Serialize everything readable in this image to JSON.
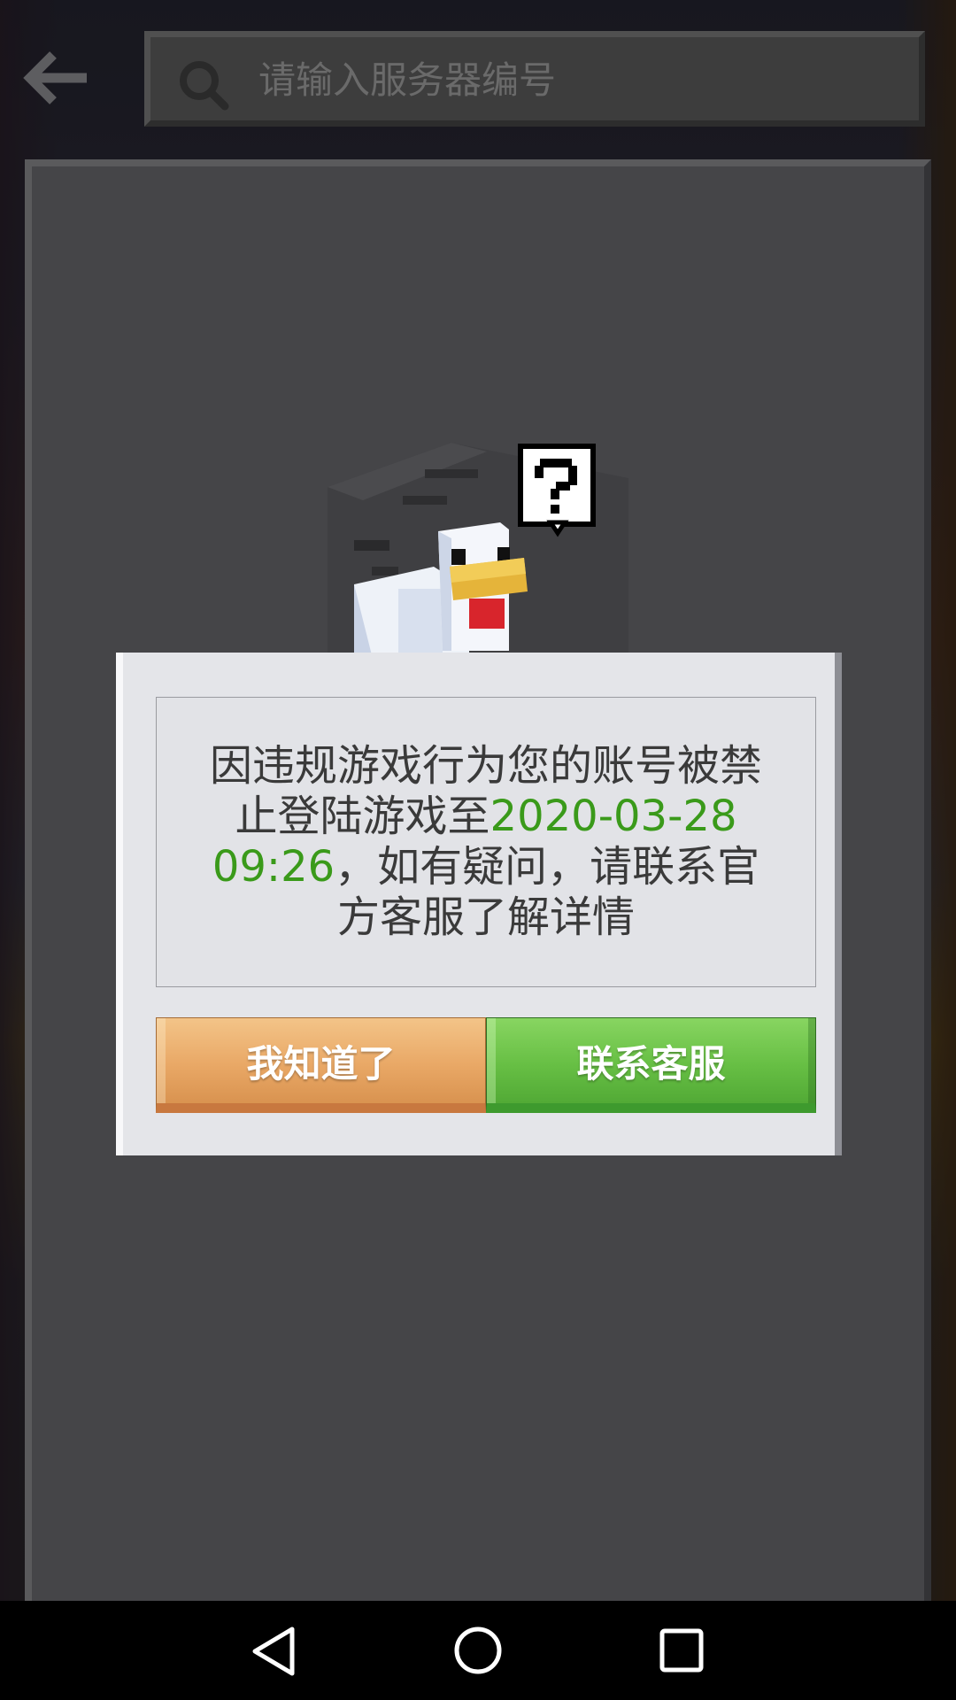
{
  "header": {
    "back_icon": "arrow-left-icon",
    "search": {
      "icon": "search-icon",
      "placeholder": "请输入服务器编号",
      "value": ""
    }
  },
  "illustration": {
    "icon": "confused-chicken-question-icon"
  },
  "dialog": {
    "message_before": "因违规游戏行为您的账号被禁止登陆游戏至",
    "ban_until": "2020-03-28 09:26",
    "message_after": "，如有疑问，请联系官方客服了解详情",
    "ok_label": "我知道了",
    "contact_label": "联系客服",
    "highlight_color": "#3a9a1a",
    "ok_color": "#e9a866",
    "contact_color": "#67bf44"
  },
  "navbar": {
    "back_icon": "triangle-back-icon",
    "home_icon": "circle-home-icon",
    "recents_icon": "square-recents-icon"
  }
}
